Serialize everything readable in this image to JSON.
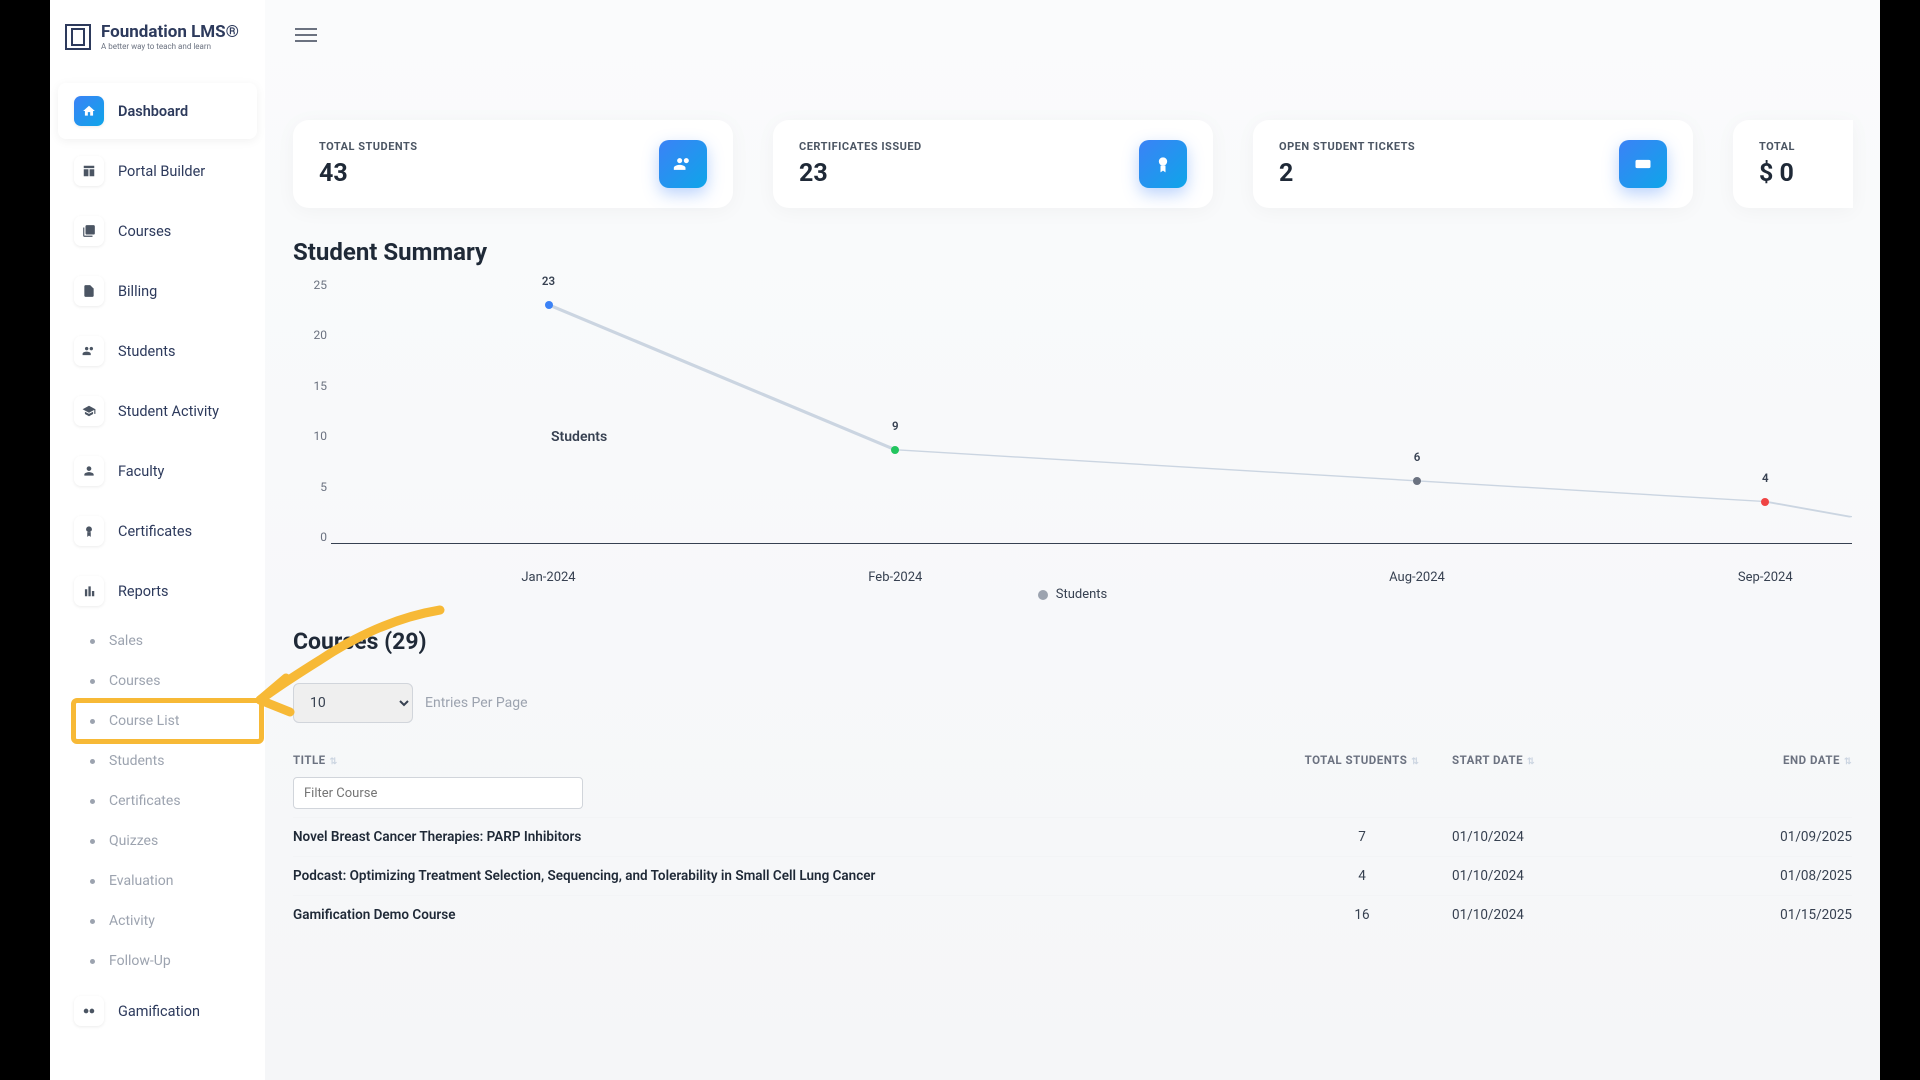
{
  "brand": {
    "name": "Foundation LMS®",
    "tagline": "A better way to teach and learn"
  },
  "sidebar": {
    "items": [
      {
        "label": "Dashboard"
      },
      {
        "label": "Portal Builder"
      },
      {
        "label": "Courses"
      },
      {
        "label": "Billing"
      },
      {
        "label": "Students"
      },
      {
        "label": "Student Activity"
      },
      {
        "label": "Faculty"
      },
      {
        "label": "Certificates"
      },
      {
        "label": "Reports"
      }
    ],
    "report_sub": [
      {
        "label": "Sales"
      },
      {
        "label": "Courses"
      },
      {
        "label": "Course List"
      },
      {
        "label": "Students"
      },
      {
        "label": "Certificates"
      },
      {
        "label": "Quizzes"
      },
      {
        "label": "Evaluation"
      },
      {
        "label": "Activity"
      },
      {
        "label": "Follow-Up"
      }
    ],
    "gamification": "Gamification"
  },
  "stats": [
    {
      "label": "TOTAL STUDENTS",
      "value": "43"
    },
    {
      "label": "CERTIFICATES ISSUED",
      "value": "23"
    },
    {
      "label": "OPEN STUDENT TICKETS",
      "value": "2"
    },
    {
      "label": "TOTAL",
      "value": "$ 0"
    }
  ],
  "chart": {
    "title": "Student Summary",
    "series_label": "Students",
    "legend": "Students"
  },
  "chart_data": {
    "type": "line",
    "title": "Student Summary",
    "xlabel": "",
    "ylabel": "",
    "ylim": [
      0,
      25
    ],
    "y_ticks": [
      25,
      20,
      15,
      10,
      5,
      0
    ],
    "categories": [
      "Jan-2024",
      "Feb-2024",
      "Aug-2024",
      "Sep-2024"
    ],
    "series": [
      {
        "name": "Students",
        "values": [
          23,
          9,
          6,
          4
        ],
        "colors": [
          "#3b82f6",
          "#22c55e",
          "#6b7280",
          "#ef4444"
        ]
      }
    ]
  },
  "courses": {
    "title": "Courses (29)",
    "entries_value": "10",
    "entries_label": "Entries Per Page",
    "filter_placeholder": "Filter Course",
    "columns": {
      "title": "TITLE",
      "students": "TOTAL STUDENTS",
      "start": "START DATE",
      "end": "END DATE"
    },
    "rows": [
      {
        "title": "Novel Breast Cancer Therapies: PARP Inhibitors",
        "students": "7",
        "start": "01/10/2024",
        "end": "01/09/2025"
      },
      {
        "title": "Podcast: Optimizing Treatment Selection, Sequencing, and Tolerability in Small Cell Lung Cancer",
        "students": "4",
        "start": "01/10/2024",
        "end": "01/08/2025"
      },
      {
        "title": "Gamification Demo Course",
        "students": "16",
        "start": "01/10/2024",
        "end": "01/15/2025"
      }
    ]
  }
}
